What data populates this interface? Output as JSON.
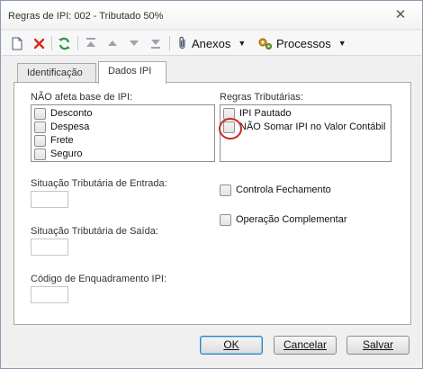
{
  "window": {
    "title": "Regras de IPI: 002 - Tributado 50%"
  },
  "toolbar": {
    "new_icon": "new-document-icon",
    "delete_icon": "delete-x-icon",
    "refresh_icon": "refresh-icon",
    "anexos_label": "Anexos",
    "processos_label": "Processos"
  },
  "tabs": [
    {
      "label": "Identificação",
      "active": false
    },
    {
      "label": "Dados IPI",
      "active": true
    }
  ],
  "form": {
    "nao_afeta_label": "NÃO afeta base de IPI:",
    "nao_afeta_items": [
      "Desconto",
      "Despesa",
      "Frete",
      "Seguro"
    ],
    "regras_label": "Regras Tributárias:",
    "regras_items": [
      "IPI Pautado",
      "NÃO Somar IPI no Valor Contábil"
    ],
    "entrada_label": "Situação Tributária de Entrada:",
    "saida_label": "Situação Tributária de Saída:",
    "enquadramento_label": "Código de Enquadramento IPI:",
    "controla_fechamento": "Controla Fechamento",
    "operacao_complementar": "Operação Complementar"
  },
  "buttons": {
    "ok": "OK",
    "cancelar": "Cancelar",
    "salvar": "Salvar"
  },
  "colors": {
    "accent": "#3c7fb1",
    "highlight": "#c82a24"
  }
}
